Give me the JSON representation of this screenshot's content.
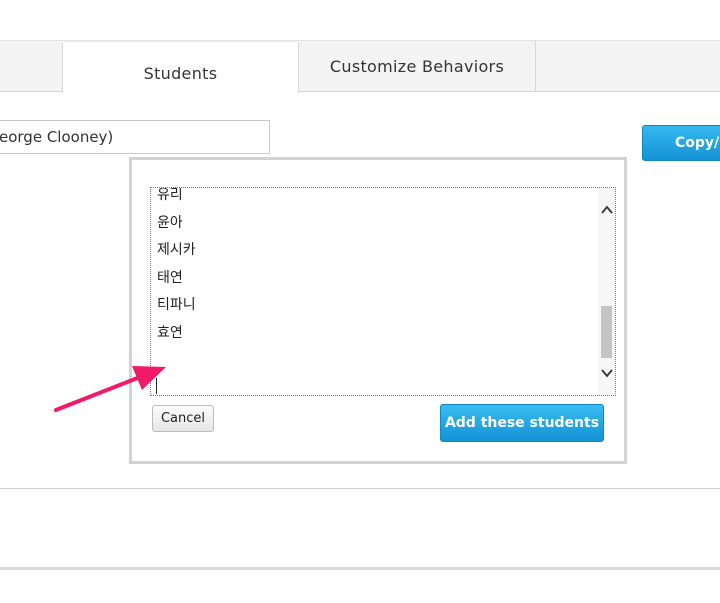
{
  "tabs": {
    "students": "Students",
    "customize": "Customize Behaviors"
  },
  "teacher_name_field": {
    "value": "eorge Clooney)"
  },
  "copy_button": {
    "label": "Copy/p"
  },
  "student_list": {
    "lines": [
      "유리",
      "윤아",
      "제시카",
      "태연",
      "티파니",
      "효연",
      ""
    ]
  },
  "dialog": {
    "cancel_label": "Cancel",
    "add_label": "Add these students"
  },
  "colors": {
    "accent_blue": "#1a9ee0",
    "arrow_pink": "#f0196a"
  }
}
